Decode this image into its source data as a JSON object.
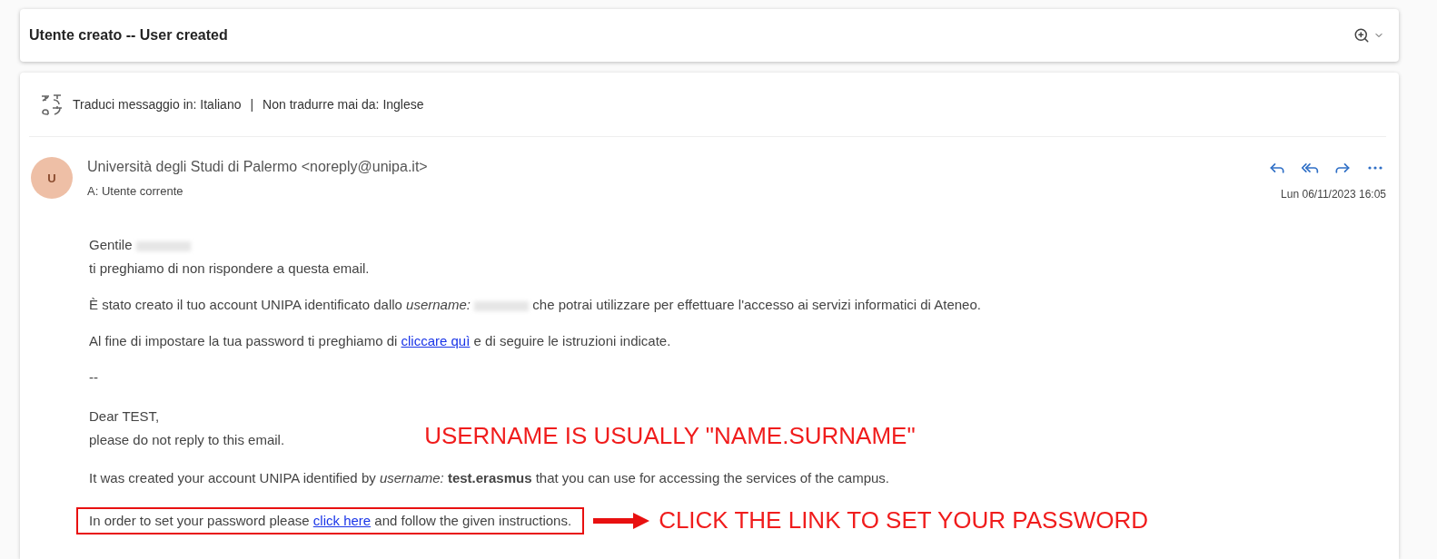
{
  "subject": "Utente creato -- User created",
  "translate_bar": {
    "translate_to": "Traduci messaggio in: Italiano",
    "separator": "|",
    "never_translate": "Non tradurre mai da: Inglese"
  },
  "message": {
    "avatar_initial": "U",
    "sender": "Università degli Studi di Palermo <noreply@unipa.it>",
    "recipient": "A:  Utente corrente",
    "date": "Lun 06/11/2023 16:05"
  },
  "body": [
    {
      "lines": [
        [
          {
            "kind": "text",
            "text": "Gentile "
          },
          {
            "kind": "redacted"
          }
        ],
        [
          {
            "kind": "text",
            "text": "ti preghiamo di non rispondere a questa email."
          }
        ]
      ]
    },
    {
      "lines": [
        [
          {
            "kind": "text",
            "text": "È stato creato il tuo account UNIPA identificato dallo *username:* "
          },
          {
            "kind": "redacted"
          },
          {
            "kind": "text",
            "text": " che potrai utilizzare per effettuare l'accesso ai servizi informatici di Ateneo."
          }
        ]
      ]
    },
    {
      "lines": [
        [
          {
            "kind": "text",
            "text": "Al fine di impostare la tua password ti preghiamo di "
          },
          {
            "kind": "link",
            "text": "cliccare quì"
          },
          {
            "kind": "text",
            "text": " e di seguire le istruzioni indicate."
          }
        ]
      ]
    },
    {
      "lines": [
        [
          {
            "kind": "text",
            "text": "--"
          }
        ]
      ]
    },
    {
      "lines": [
        [
          {
            "kind": "text",
            "text": "Dear TEST,"
          }
        ],
        [
          {
            "kind": "text",
            "text": "please do not reply to this email."
          }
        ]
      ],
      "annotation": "USERNAME IS USUALLY \"NAME.SURNAME\""
    },
    {
      "lines": [
        [
          {
            "kind": "text",
            "text": "It was created your account UNIPA identified by *username:* **test.erasmus** that you can use for accessing the services of the campus."
          }
        ]
      ]
    },
    {
      "lines": [
        [
          {
            "kind": "text",
            "text": "In order to set your password please "
          },
          {
            "kind": "link",
            "text": "click here"
          },
          {
            "kind": "text",
            "text": " and follow the given instructions."
          }
        ]
      ],
      "highlighted": true,
      "annotation": "CLICK THE LINK TO SET YOUR PASSWORD"
    }
  ]
}
